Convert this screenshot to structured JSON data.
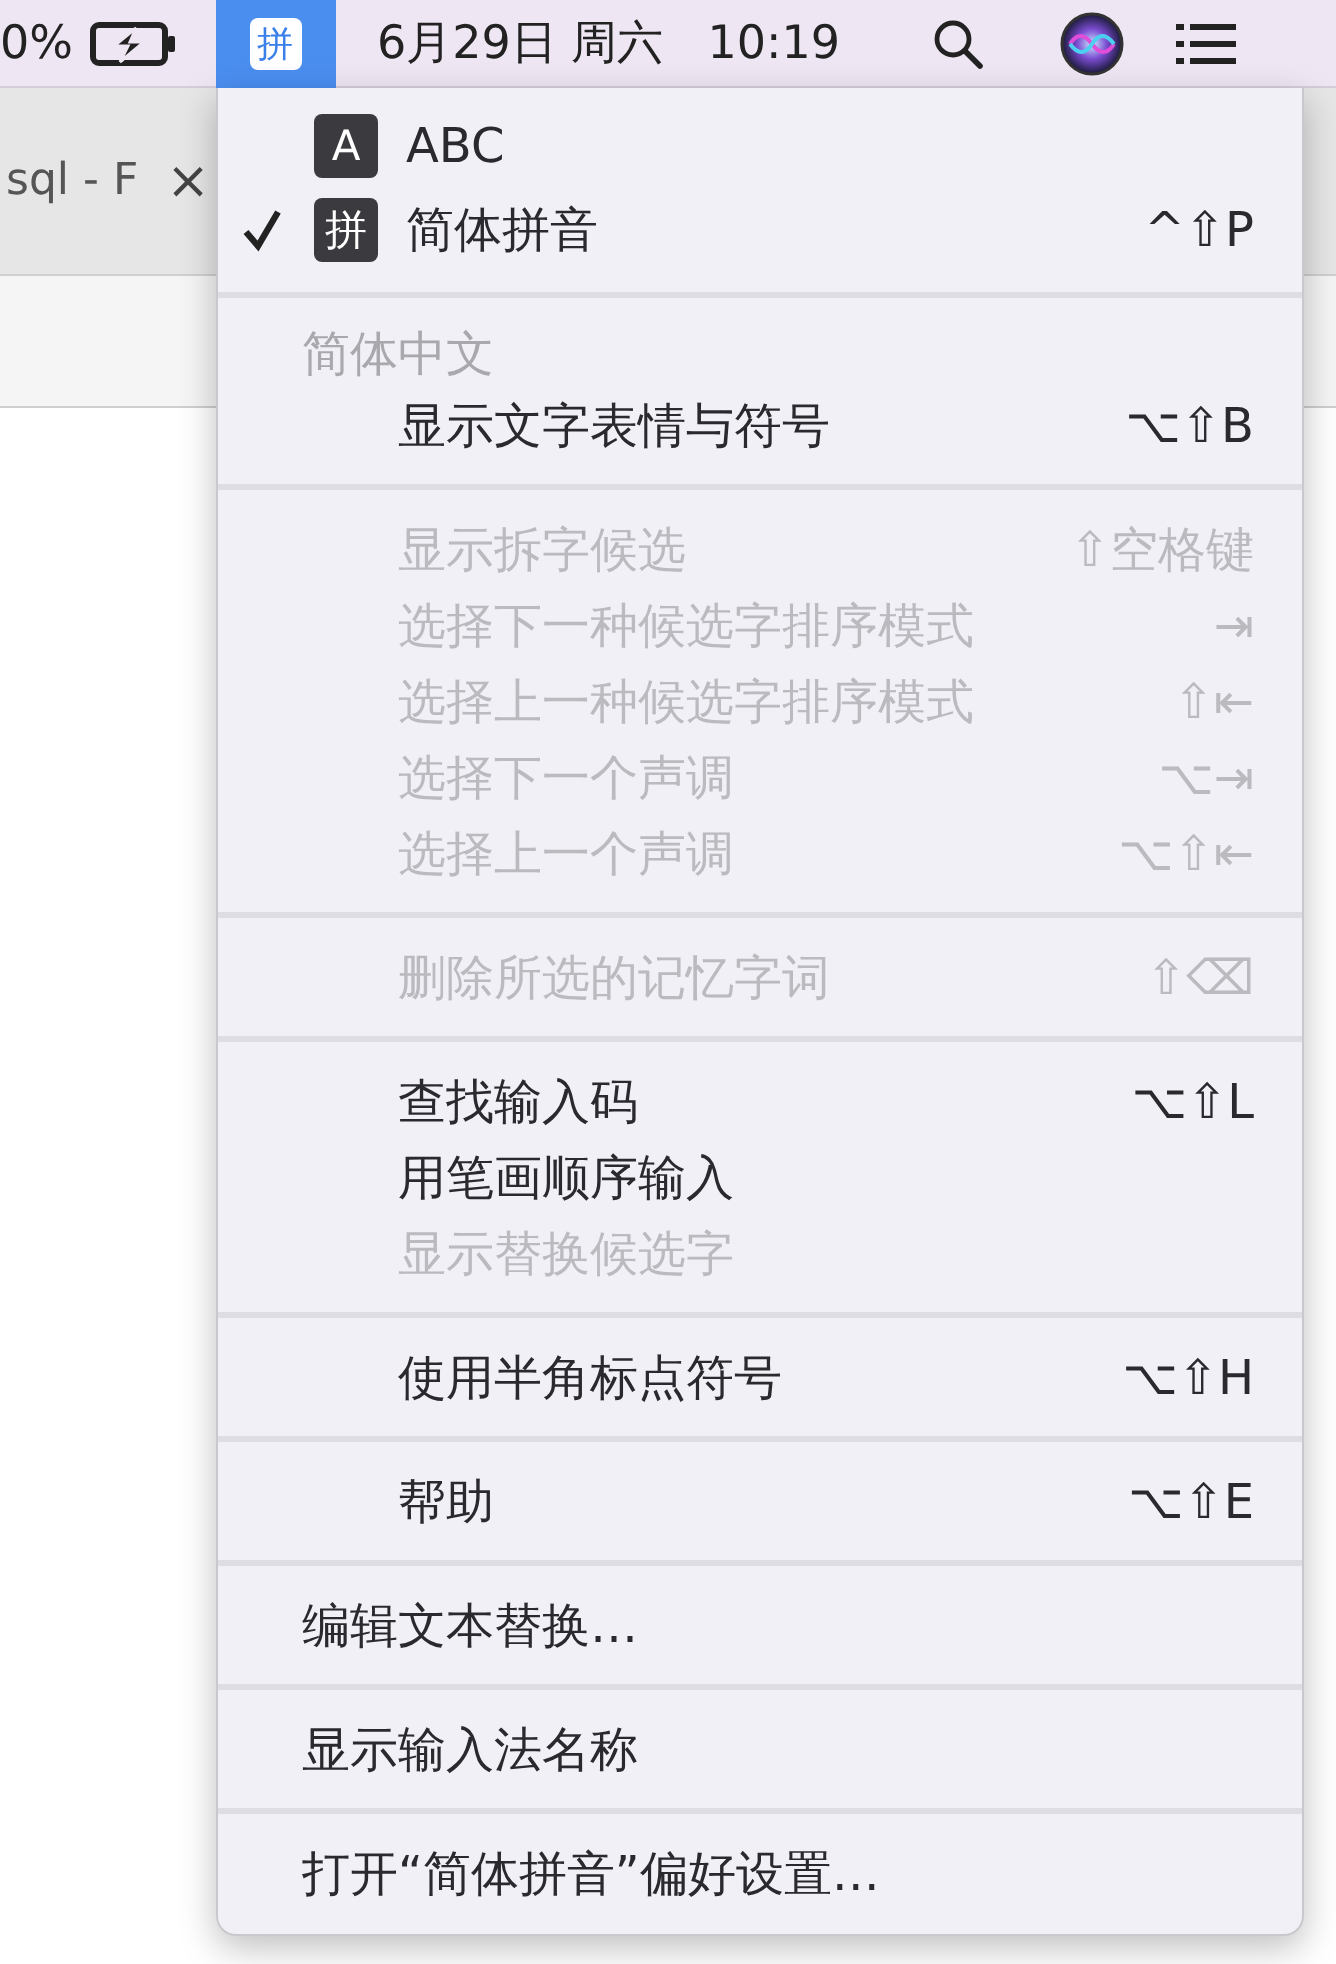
{
  "menu_bar": {
    "battery_text": "0%",
    "input_menu": {
      "label": "拼",
      "selected": true
    },
    "date": "6月29日 周六",
    "time": "10:19"
  },
  "browser": {
    "tab_title": "sql - F",
    "tab_close": "×"
  },
  "input_menu": {
    "sections": [
      {
        "items": [
          {
            "kind": "source",
            "badge": "A",
            "label": "ABC",
            "checked": false
          },
          {
            "kind": "source",
            "badge": "拼",
            "label": "简体拼音",
            "checked": true,
            "shortcut": "^⇧P"
          }
        ]
      },
      {
        "items": [
          {
            "kind": "header",
            "label": "简体中文"
          },
          {
            "kind": "command",
            "label": "显示文字表情与符号",
            "disabled": false,
            "shortcut": "⌥⇧B"
          }
        ]
      },
      {
        "items": [
          {
            "kind": "command",
            "label": "显示拆字候选",
            "disabled": true,
            "shortcut": "⇧空格键"
          },
          {
            "kind": "command",
            "label": "选择下一种候选字排序模式",
            "disabled": true,
            "shortcut": "⇥"
          },
          {
            "kind": "command",
            "label": "选择上一种候选字排序模式",
            "disabled": true,
            "shortcut": "⇧⇤"
          },
          {
            "kind": "command",
            "label": "选择下一个声调",
            "disabled": true,
            "shortcut": "⌥⇥"
          },
          {
            "kind": "command",
            "label": "选择上一个声调",
            "disabled": true,
            "shortcut": "⌥⇧⇤"
          }
        ]
      },
      {
        "items": [
          {
            "kind": "command",
            "label": "删除所选的记忆字词",
            "disabled": true,
            "shortcut": "⇧⌫"
          }
        ]
      },
      {
        "items": [
          {
            "kind": "command",
            "label": "查找输入码",
            "disabled": false,
            "shortcut": "⌥⇧L"
          },
          {
            "kind": "command",
            "label": "用笔画顺序输入",
            "disabled": false
          },
          {
            "kind": "command",
            "label": "显示替换候选字",
            "disabled": true
          }
        ]
      },
      {
        "items": [
          {
            "kind": "command",
            "label": "使用半角标点符号",
            "disabled": false,
            "shortcut": "⌥⇧H"
          }
        ]
      },
      {
        "items": [
          {
            "kind": "command",
            "label": "帮助",
            "disabled": false,
            "shortcut": "⌥⇧E"
          }
        ]
      },
      {
        "items": [
          {
            "kind": "plain",
            "label": "编辑文本替换…",
            "disabled": false
          }
        ]
      },
      {
        "items": [
          {
            "kind": "plain",
            "label": "显示输入法名称",
            "disabled": false
          }
        ]
      },
      {
        "items": [
          {
            "kind": "plain",
            "label": "打开“简体拼音”偏好设置…",
            "disabled": false
          }
        ]
      }
    ]
  }
}
